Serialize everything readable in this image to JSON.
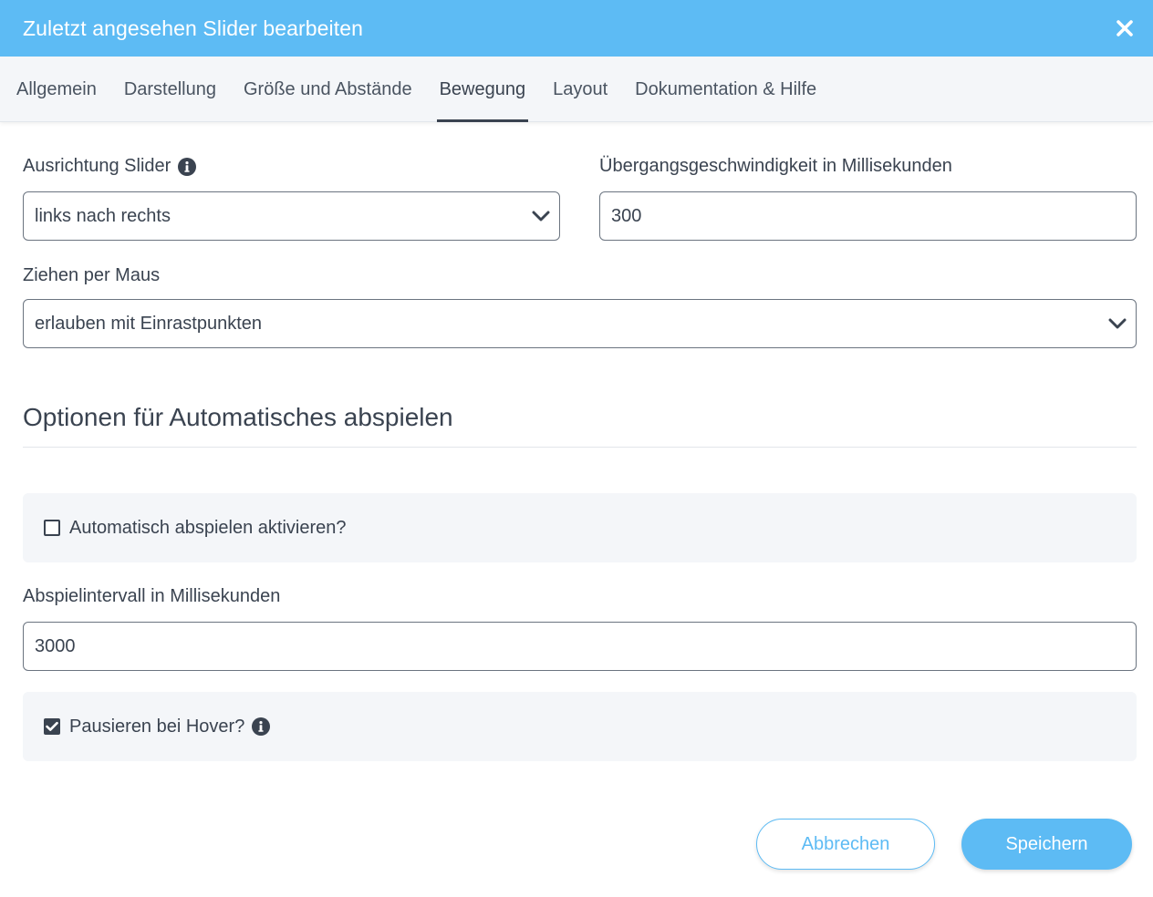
{
  "dialog": {
    "title": "Zuletzt angesehen Slider bearbeiten",
    "close_icon": "close-icon"
  },
  "tabs": [
    {
      "label": "Allgemein",
      "active": false
    },
    {
      "label": "Darstellung",
      "active": false
    },
    {
      "label": "Größe und Abstände",
      "active": false
    },
    {
      "label": "Bewegung",
      "active": true
    },
    {
      "label": "Layout",
      "active": false
    },
    {
      "label": "Dokumentation & Hilfe",
      "active": false
    }
  ],
  "form": {
    "direction": {
      "label": "Ausrichtung Slider",
      "value": "links nach rechts",
      "icon": "info-icon"
    },
    "speed": {
      "label": "Übergangsgeschwindigkeit in Millisekunden",
      "value": "300"
    },
    "drag": {
      "label": "Ziehen per Maus",
      "value": "erlauben mit Einrastpunkten"
    }
  },
  "autoplay": {
    "section_title": "Optionen für Automatisches abspielen",
    "enable": {
      "label": "Automatisch abspielen aktivieren?",
      "checked": false
    },
    "interval": {
      "label": "Abspielintervall in Millisekunden",
      "value": "3000"
    },
    "pause_hover": {
      "label": "Pausieren bei Hover?",
      "checked": true,
      "icon": "info-icon"
    }
  },
  "footer": {
    "cancel_label": "Abbrechen",
    "save_label": "Speichern"
  },
  "colors": {
    "accent": "#5dbbf4",
    "text": "#3a4350",
    "panel_bg": "#f4f6f9"
  }
}
